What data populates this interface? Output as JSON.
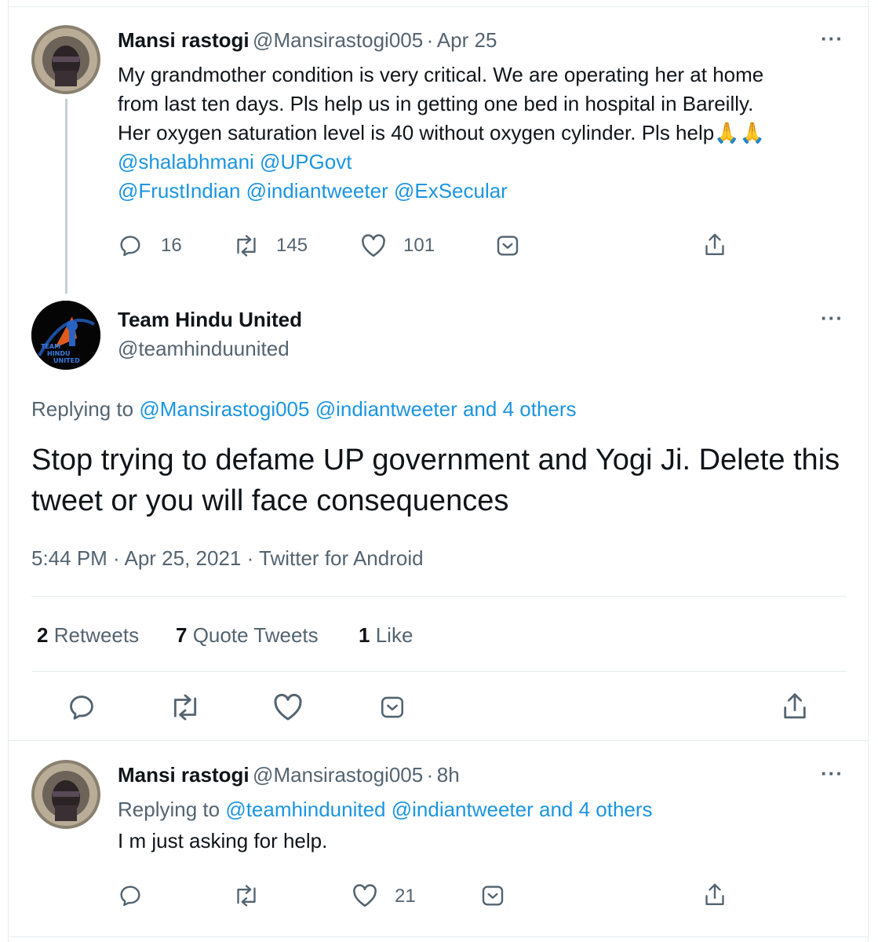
{
  "tweet1": {
    "name": "Mansi rastogi",
    "handle": "@Mansirastogi005",
    "sep": "·",
    "time": "Apr 25",
    "line1": "My grandmother condition is very critical. We are operating her at home",
    "line2": "from last ten days. Pls help us in getting one bed in hospital in Bareilly.",
    "line3": "Her oxygen saturation level is 40 without oxygen cylinder. Pls help🙏🙏",
    "mention_line1": "@shalabhmani @UPGovt",
    "mention_line2": "@FrustIndian @indiantweeter @ExSecular",
    "more": "···",
    "replies": "16",
    "retweets": "145",
    "likes": "101"
  },
  "tweet2": {
    "name": "Team Hindu United",
    "handle": "@teamhinduunited",
    "more": "···",
    "avatar_text": [
      "TEAM",
      "HINDU",
      "UNITED"
    ],
    "replying_prefix": "Replying to",
    "replying_mentions": "@Mansirastogi005 @indiantweeter and 4 others",
    "text": "Stop trying to defame UP government and Yogi Ji. Delete this tweet or you will face consequences",
    "meta": "5:44 PM · Apr 25, 2021 · Twitter for Android",
    "stats": {
      "retweets_num": "2",
      "retweets_label": "Retweets",
      "quotes_num": "7",
      "quotes_label": "Quote Tweets",
      "likes_num": "1",
      "likes_label": "Like"
    }
  },
  "tweet3": {
    "name": "Mansi rastogi",
    "handle": "@Mansirastogi005",
    "sep": "·",
    "time": "8h",
    "more": "···",
    "replying_prefix": "Replying to",
    "replying_mentions": "@teamhindunited @indiantweeter and 4 others",
    "text": "I m just asking for help.",
    "likes": "21"
  },
  "colors": {
    "text": "#0f1419",
    "secondary": "#536471",
    "link": "#1b95e0",
    "border": "#e6ecf0",
    "thread": "#c4cfd6"
  },
  "icons": [
    "reply-icon",
    "retweet-icon",
    "like-icon",
    "dm-icon",
    "share-icon",
    "more-icon"
  ]
}
